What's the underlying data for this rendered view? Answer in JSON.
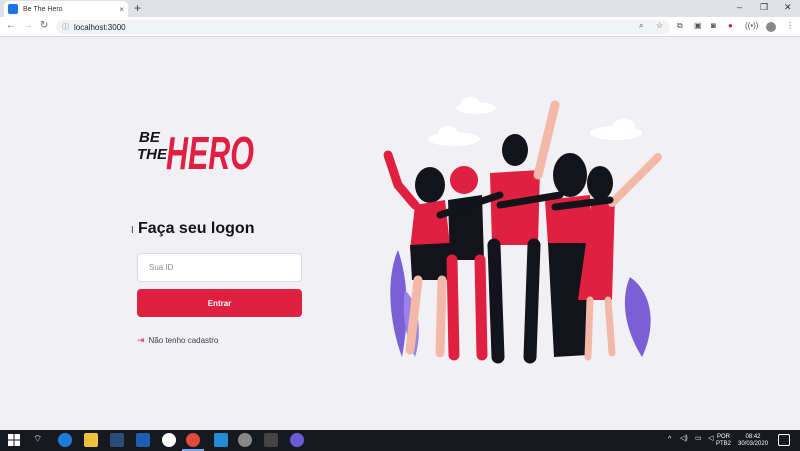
{
  "browser": {
    "tab_title": "Be The Hero",
    "tab_close": "×",
    "new_tab": "+",
    "url": "localhost:3000",
    "info_icon": "ⓘ",
    "window_controls": [
      "–",
      "❐",
      "✕"
    ]
  },
  "brand": {
    "primary_color": "#e02041",
    "background_color": "#f0f0f5",
    "logo_small_top": "BE",
    "logo_small_bottom": "THE",
    "logo_big": "HERO"
  },
  "login": {
    "title": "Faça seu logon",
    "id_placeholder": "Sua ID",
    "submit_label": "Entrar",
    "register_label": "Não tenho cadastro",
    "register_icon": "log-in-icon"
  },
  "taskbar": {
    "language": "POR",
    "layout": "PTB2",
    "time": "08:42",
    "date": "30/03/2020"
  }
}
